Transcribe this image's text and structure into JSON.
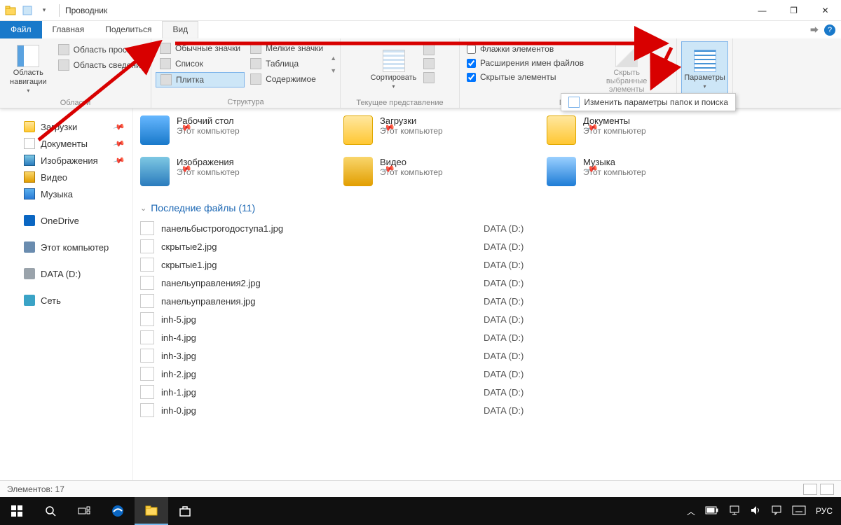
{
  "window": {
    "title": "Проводник",
    "minimize": "—",
    "maximize": "❐",
    "close": "✕"
  },
  "tabs": {
    "file": "Файл",
    "home": "Главная",
    "share": "Поделиться",
    "view": "Вид"
  },
  "ribbon": {
    "panes": {
      "nav": "Область навигации",
      "preview": "Область просмотра",
      "details": "Область сведений",
      "group_label": "Области"
    },
    "layout": {
      "regular": "Обычные значки",
      "small": "Мелкие значки",
      "list": "Список",
      "table": "Таблица",
      "tiles": "Плитка",
      "content": "Содержимое",
      "group_label": "Структура"
    },
    "sort": {
      "button": "Сортировать",
      "group_label": "Текущее представление"
    },
    "showhide": {
      "chk_flags": "Флажки элементов",
      "chk_ext": "Расширения имен файлов",
      "chk_hidden": "Скрытые элементы",
      "hide_selected": "Скрыть выбранные элементы",
      "group_label": "Пока"
    },
    "options": {
      "button": "Параметры",
      "dropdown_item": "Изменить параметры папок и поиска"
    }
  },
  "sidebar": {
    "items": [
      {
        "label": "Загрузки",
        "icon": "ic-folder",
        "pinned": true
      },
      {
        "label": "Документы",
        "icon": "ic-doc",
        "pinned": true
      },
      {
        "label": "Изображения",
        "icon": "ic-pic",
        "pinned": true
      },
      {
        "label": "Видео",
        "icon": "ic-vid",
        "pinned": false
      },
      {
        "label": "Музыка",
        "icon": "ic-music",
        "pinned": false
      }
    ],
    "onedrive": "OneDrive",
    "thispc": "Этот компьютер",
    "drive": "DATA (D:)",
    "network": "Сеть"
  },
  "tiles": [
    {
      "name": "Рабочий стол",
      "sub": "Этот компьютер",
      "icon": "big-blue",
      "pin": true
    },
    {
      "name": "Загрузки",
      "sub": "Этот компьютер",
      "icon": "big-folder",
      "pin": true
    },
    {
      "name": "Документы",
      "sub": "Этот компьютер",
      "icon": "big-folder",
      "pin": true
    },
    {
      "name": "Изображения",
      "sub": "Этот компьютер",
      "icon": "big-pic",
      "pin": true
    },
    {
      "name": "Видео",
      "sub": "Этот компьютер",
      "icon": "big-vid",
      "pin": true
    },
    {
      "name": "Музыка",
      "sub": "Этот компьютер",
      "icon": "big-music",
      "pin": true
    }
  ],
  "recent": {
    "header": "Последние файлы (11)",
    "location": "DATA (D:)",
    "files": [
      "панельбыстрогодоступа1.jpg",
      "скрытые2.jpg",
      "скрытые1.jpg",
      "панельуправления2.jpg",
      "панельуправления.jpg",
      "inh-5.jpg",
      "inh-4.jpg",
      "inh-3.jpg",
      "inh-2.jpg",
      "inh-1.jpg",
      "inh-0.jpg"
    ]
  },
  "status": {
    "count": "Элементов: 17"
  },
  "taskbar": {
    "lang": "РУС"
  }
}
